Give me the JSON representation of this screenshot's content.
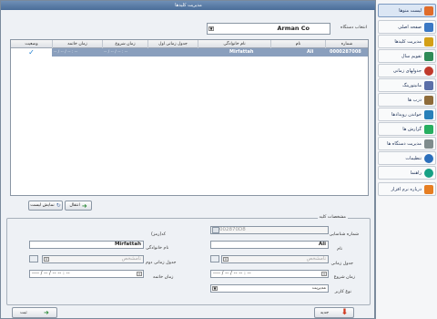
{
  "window": {
    "title": "مدیریت کلیدها"
  },
  "device_select": {
    "label": "انتخاب دستگاه",
    "value": "Arman Co"
  },
  "grid": {
    "headers": [
      "شماره",
      "نام",
      "نام خانوادگی",
      "جدول زمانی اول",
      "زمان شروع",
      "زمان خاتمه",
      "وضعیت"
    ],
    "rows": [
      {
        "number": "0000287008",
        "first": "Ali",
        "last": "Mirfattah",
        "schedule": "",
        "start": "-- / -- / -- : --",
        "end": "-- / -- / -- : --",
        "status": "✓"
      }
    ]
  },
  "actions": {
    "transfer": "انتقال",
    "show_list": "نمایش لیست"
  },
  "details": {
    "legend": "مشخصات کلید",
    "id_label": "شماره شناسایی",
    "id_value": "00002870D8",
    "code_label": "کد(رمز)",
    "first_label": "نام",
    "first_value": "Ali",
    "last_label": "نام خانوادگی",
    "last_value": "Mirfattah",
    "sched1_label": "جدول زمانی",
    "sched1_placeholder": "نامشخص",
    "sched2_label": "جدول زمانی دوم",
    "sched2_placeholder": "نامشخص",
    "start_label": "زمان شروع",
    "start_value": "---- / -- / --   -- : --",
    "end_label": "زمان خاتمه",
    "end_value": "---- / -- / --   -- : --",
    "user_type_label": "نوع کاربر",
    "user_type_value": "مدیریت"
  },
  "footer": {
    "new": "جدید",
    "save": "ثبت"
  },
  "sidebar": {
    "items": [
      {
        "label": "لیست منوها",
        "color": "#e06c2a"
      },
      {
        "label": "صفحه اصلی",
        "color": "#3b78c4"
      },
      {
        "label": "مدیریت کلیدها",
        "color": "#d4a017"
      },
      {
        "label": "تقویم سال",
        "color": "#2e8b57"
      },
      {
        "label": "جدولهای زمانی",
        "color": "#c0392b"
      },
      {
        "label": "مانیتورینگ",
        "color": "#5b6fa8"
      },
      {
        "label": "درب ها",
        "color": "#8e6b3a"
      },
      {
        "label": "خواندن رویدادها",
        "color": "#2980b9"
      },
      {
        "label": "گزارش ها",
        "color": "#27ae60"
      },
      {
        "label": "مدیریت دستگاه ها",
        "color": "#7f8c8d"
      },
      {
        "label": "تنظیمات",
        "color": "#2c6fbb"
      },
      {
        "label": "راهنما",
        "color": "#16a085"
      },
      {
        "label": "درباره نرم افزار",
        "color": "#e67e22"
      }
    ]
  }
}
